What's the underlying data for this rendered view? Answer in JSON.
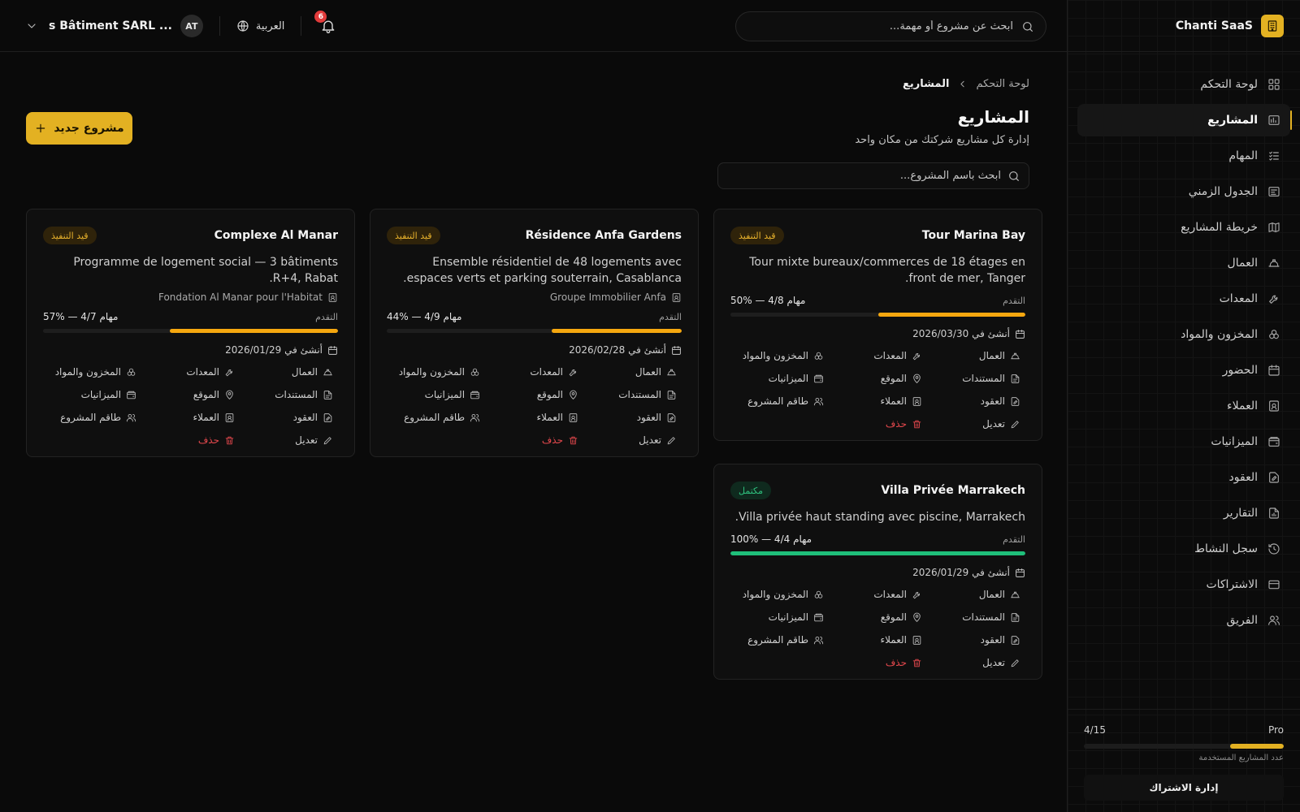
{
  "brand": {
    "name": "Chanti SaaS",
    "icon": "building-icon"
  },
  "sidebar": {
    "items": [
      {
        "label": "لوحة التحكم",
        "icon": "dashboard-icon",
        "active": false
      },
      {
        "label": "المشاريع",
        "icon": "projects-icon",
        "active": true
      },
      {
        "label": "المهام",
        "icon": "tasks-icon",
        "active": false
      },
      {
        "label": "الجدول الزمني",
        "icon": "timeline-icon",
        "active": false
      },
      {
        "label": "خريطة المشاريع",
        "icon": "map-icon",
        "active": false
      },
      {
        "label": "العمال",
        "icon": "hardhat-icon",
        "active": false
      },
      {
        "label": "المعدات",
        "icon": "wrench-icon",
        "active": false
      },
      {
        "label": "المخزون والمواد",
        "icon": "boxes-icon",
        "active": false
      },
      {
        "label": "الحضور",
        "icon": "calendar-icon",
        "active": false
      },
      {
        "label": "العملاء",
        "icon": "contact-icon",
        "active": false
      },
      {
        "label": "الميزانيات",
        "icon": "wallet-icon",
        "active": false
      },
      {
        "label": "العقود",
        "icon": "contract-icon",
        "active": false
      },
      {
        "label": "التقارير",
        "icon": "report-icon",
        "active": false
      },
      {
        "label": "سجل النشاط",
        "icon": "history-icon",
        "active": false
      },
      {
        "label": "الاشتراكات",
        "icon": "credit-card-icon",
        "active": false
      },
      {
        "label": "الفريق",
        "icon": "users-icon",
        "active": false
      }
    ],
    "plan": {
      "name": "Pro",
      "usage": "4/15",
      "usage_fraction": 0.27,
      "caption": "عدد المشاريع المستخدمة",
      "manage_label": "إدارة الاشتراك"
    }
  },
  "header": {
    "search_placeholder": "ابحث عن مشروع أو مهمة...",
    "notifications": "6",
    "language": "العربية",
    "avatar": "AT",
    "company": "s Bâtiment SARL ..."
  },
  "page": {
    "breadcrumb": {
      "root": "لوحة التحكم",
      "current": "المشاريع"
    },
    "title": "المشاريع",
    "subtitle": "إدارة كل مشاريع شركتك من مكان واحد",
    "new_button": "مشروع جديد",
    "search_placeholder": "ابحث باسم المشروع..."
  },
  "labels": {
    "progress": "التقدم",
    "created_prefix": "أنشئ في",
    "workers": "العمال",
    "equipment": "المعدات",
    "inventory": "المخزون والمواد",
    "documents": "المستندات",
    "location": "الموقع",
    "budgets": "الميزانيات",
    "contracts": "العقود",
    "clients": "العملاء",
    "team": "طاقم المشروع",
    "edit": "تعديل",
    "delete": "حذف"
  },
  "colors": {
    "accent": "#e3b122",
    "progress_running": "#f5a70f",
    "progress_done": "#1fbf7a",
    "danger": "#e5484d"
  },
  "projects": [
    {
      "name": "Tour Marina Bay",
      "status": "قيد التنفيذ",
      "status_kind": "running",
      "description": "Tour mixte bureaux/commerces de 18 étages en front de mer, Tanger.",
      "client": "",
      "progress": 50,
      "progress_text": "50% — 4/8 مهام",
      "created": "أنشئ في 2026/03/30"
    },
    {
      "name": "Résidence Anfa Gardens",
      "status": "قيد التنفيذ",
      "status_kind": "running",
      "description": "Ensemble résidentiel de 48 logements avec espaces verts et parking souterrain, Casablanca.",
      "client": "Groupe Immobilier Anfa",
      "progress": 44,
      "progress_text": "44% — 4/9 مهام",
      "created": "أنشئ في 2026/02/28"
    },
    {
      "name": "Complexe Al Manar",
      "status": "قيد التنفيذ",
      "status_kind": "running",
      "description": "Programme de logement social — 3 bâtiments R+4, Rabat.",
      "client": "Fondation Al Manar pour l'Habitat",
      "progress": 57,
      "progress_text": "57% — 4/7 مهام",
      "created": "أنشئ في 2026/01/29"
    },
    {
      "name": "Villa Privée Marrakech",
      "status": "مكتمل",
      "status_kind": "done",
      "description": "Villa privée haut standing avec piscine, Marrakech.",
      "client": "",
      "progress": 100,
      "progress_text": "100% — 4/4 مهام",
      "created": "أنشئ في 2026/01/29"
    }
  ]
}
